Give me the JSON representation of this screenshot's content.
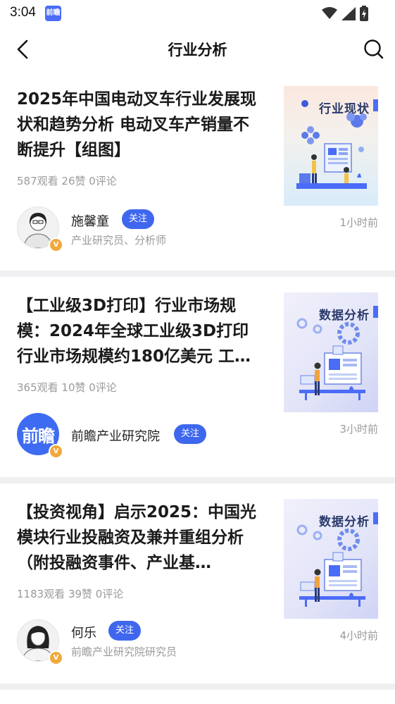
{
  "status_bar": {
    "time": "3:04",
    "app_badge": "前瞻"
  },
  "header": {
    "title": "行业分析"
  },
  "articles": [
    {
      "title": "2025年中国电动叉车行业发展现状和趋势分析 电动叉车产销量不断提升【组图】",
      "stats": "587观看 26赞 0评论",
      "author": "施馨童",
      "author_role": "产业研究员、分析师",
      "follow_label": "关注",
      "verified_mark": "V",
      "time_ago": "1小时前",
      "thumb_label": "行业现状"
    },
    {
      "title": "【工业级3D打印】行业市场规模：2024年全球工业级3D打印行业市场规模约180亿美元 工…",
      "stats": "365观看 10赞 0评论",
      "author": "前瞻产业研究院",
      "author_role": "",
      "avatar_text": "前瞻",
      "follow_label": "关注",
      "verified_mark": "V",
      "time_ago": "3小时前",
      "thumb_label": "数据分析"
    },
    {
      "title": "【投资视角】启示2025：中国光模块行业投融资及兼并重组分析（附投融资事件、产业基…",
      "stats": "1183观看 39赞 0评论",
      "author": "何乐",
      "author_role": "前瞻产业研究院研究员",
      "follow_label": "关注",
      "verified_mark": "V",
      "time_ago": "4小时前",
      "thumb_label": "数据分析"
    }
  ],
  "colors": {
    "accent": "#3f67ee",
    "verified": "#f0a93a",
    "muted": "#9a9a9a",
    "divider": "#f0f0f2"
  }
}
